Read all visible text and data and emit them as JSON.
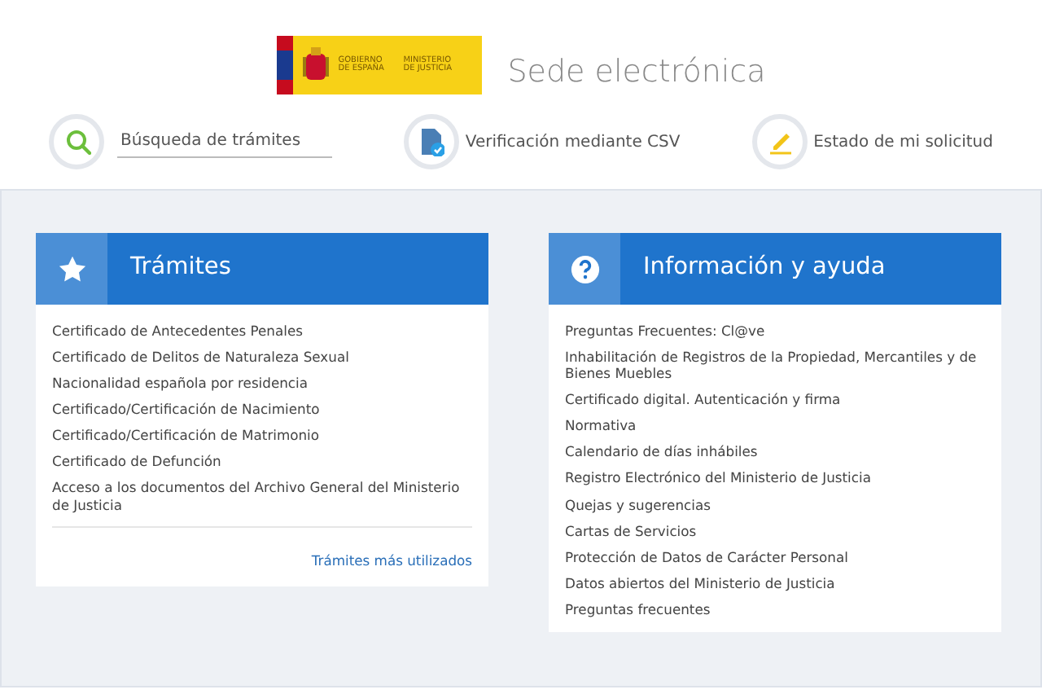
{
  "header": {
    "logo": {
      "lines": [
        "GOBIERNO DE ESPAÑA",
        "MINISTERIO DE JUSTICIA"
      ]
    },
    "title": "Sede electrónica"
  },
  "quick_links": [
    {
      "kind": "search",
      "placeholder": "Búsqueda de trámites"
    },
    {
      "kind": "verify",
      "label": "Verificación mediante CSV"
    },
    {
      "kind": "status",
      "label": "Estado de mi solicitud"
    }
  ],
  "panels": [
    {
      "kind": "star",
      "title": "Trámites",
      "items": [
        "Certificado de Antecedentes Penales",
        "Certificado de Delitos de Naturaleza Sexual",
        "Nacionalidad española por residencia",
        "Certificado/Certificación de Nacimiento",
        "Certificado/Certificación de Matrimonio",
        "Certificado de Defunción",
        "Acceso a los documentos del Archivo General del Ministerio de Justicia"
      ],
      "footer_link": "Trámites más utilizados"
    },
    {
      "kind": "help",
      "title": "Información y ayuda",
      "items": [
        "Preguntas Frecuentes: Cl@ve",
        "Inhabilitación de Registros de la Propiedad, Mercantiles y de Bienes Muebles",
        "Certificado digital. Autenticación y firma",
        "Normativa",
        "Calendario de días inhábiles",
        "Registro Electrónico del Ministerio de Justicia",
        "Quejas y sugerencias",
        "Cartas de Servicios",
        "Protección de Datos de Carácter Personal",
        "Datos abiertos del Ministerio de Justicia",
        "Preguntas frecuentes"
      ]
    }
  ]
}
